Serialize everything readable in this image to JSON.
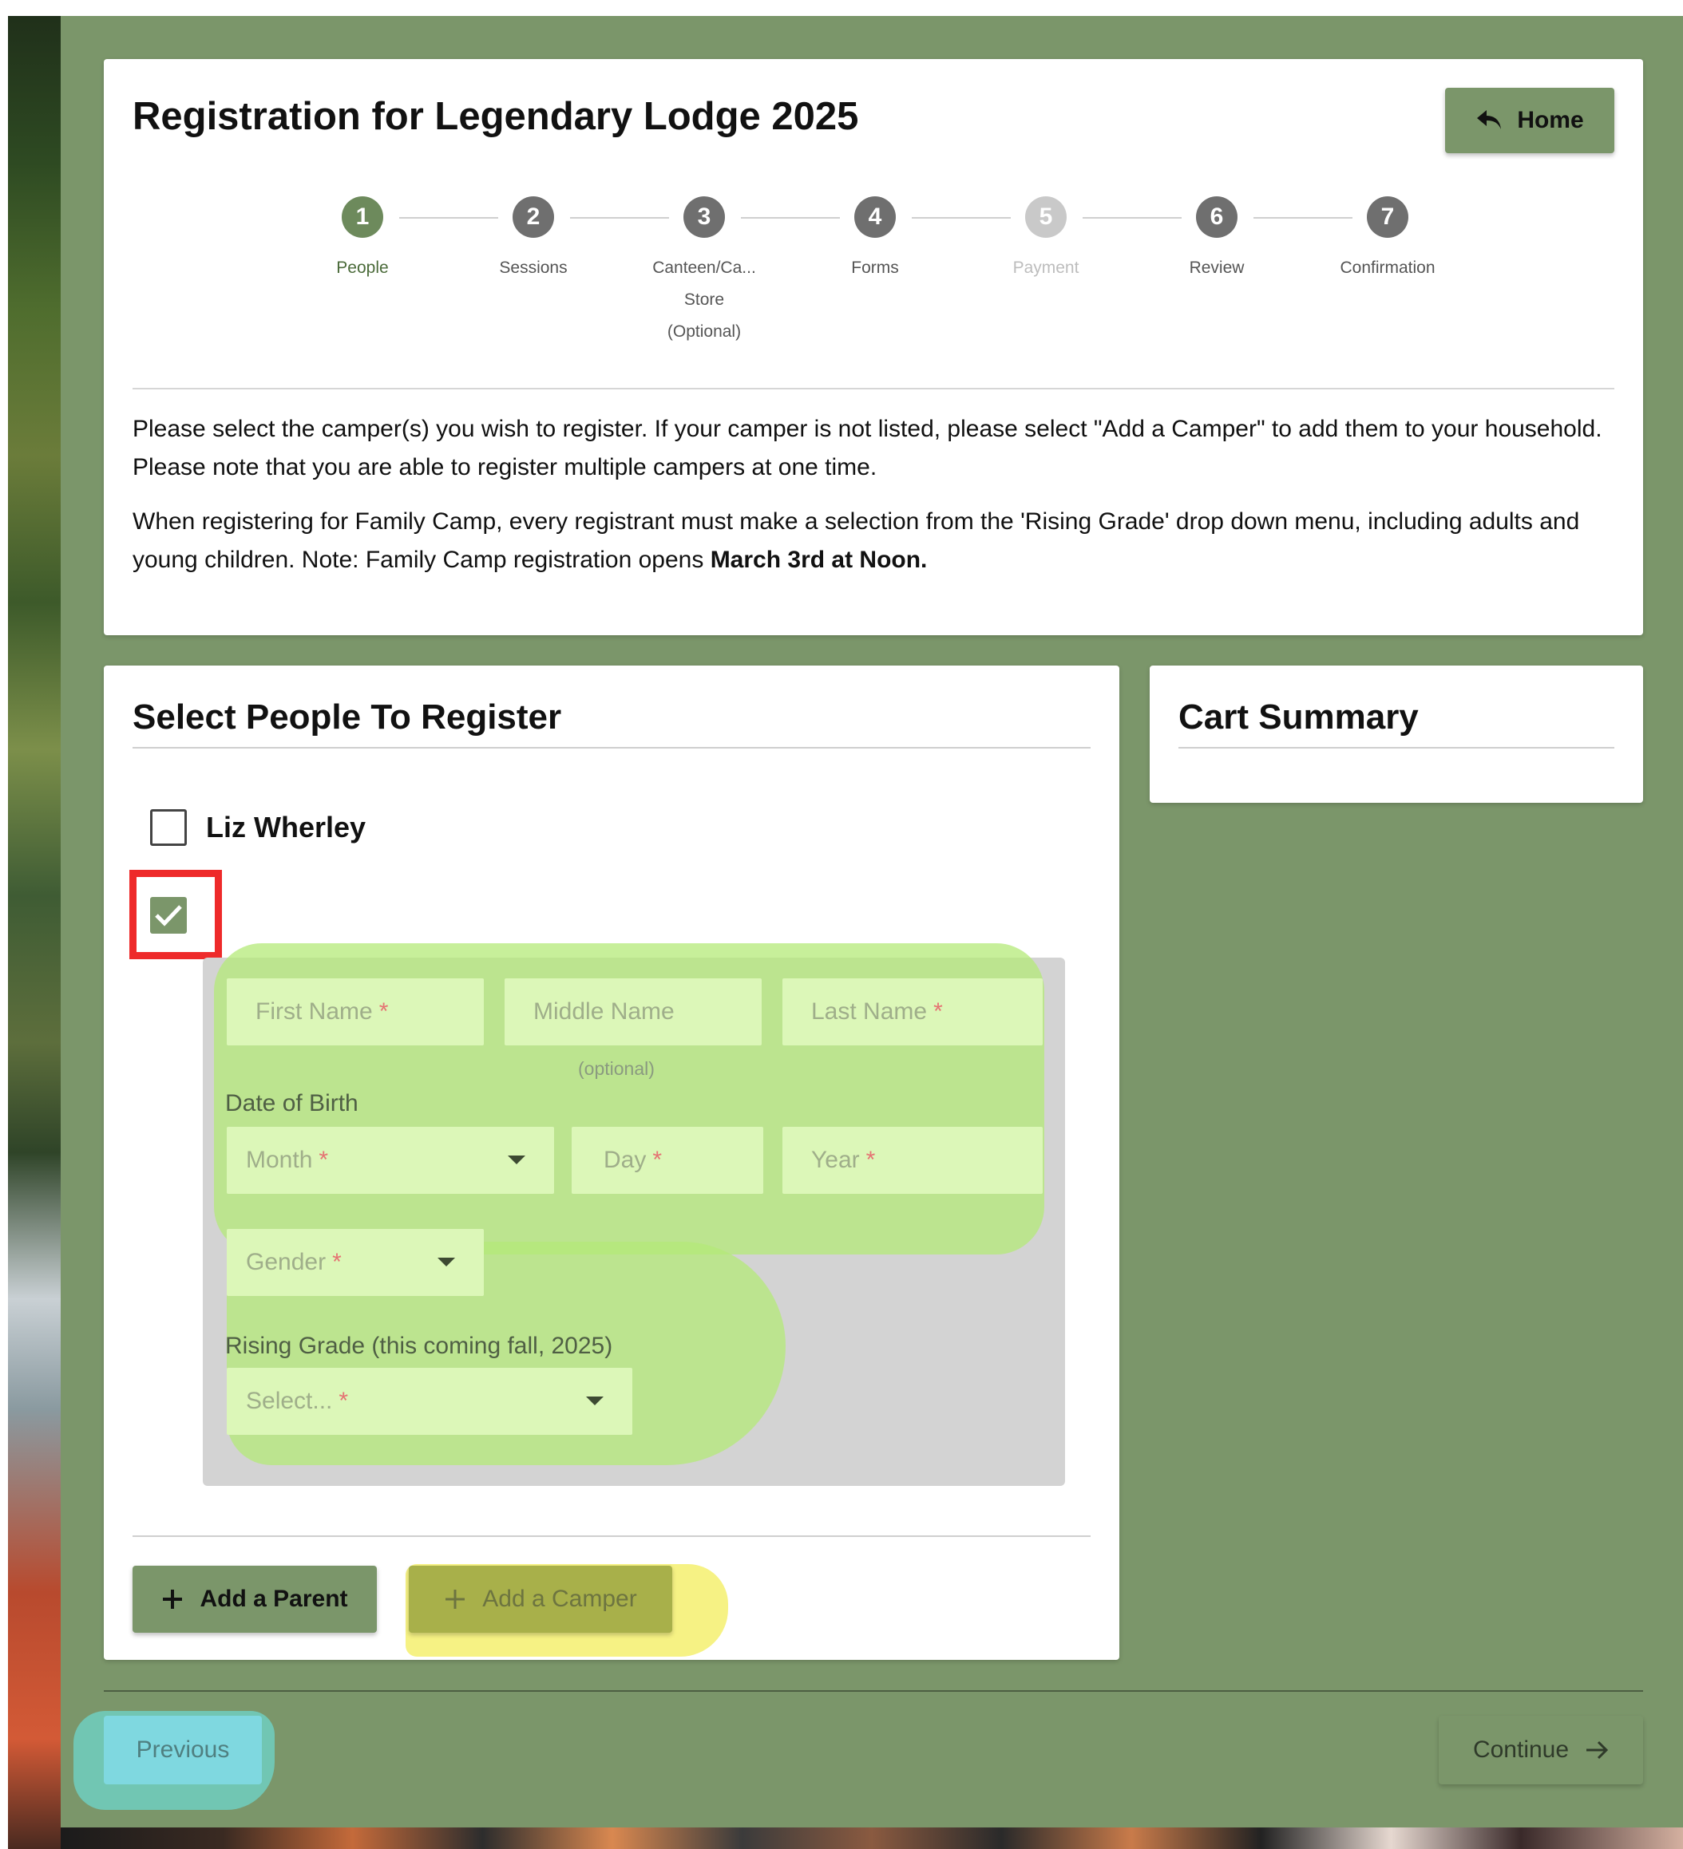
{
  "header": {
    "title": "Registration for Legendary Lodge 2025",
    "home_label": "Home"
  },
  "steps": [
    {
      "number": "1",
      "label": "People",
      "state": "active"
    },
    {
      "number": "2",
      "label": "Sessions",
      "state": "normal"
    },
    {
      "number": "3",
      "label": "Canteen/Ca...",
      "label2": "Store",
      "label3": "(Optional)",
      "state": "normal"
    },
    {
      "number": "4",
      "label": "Forms",
      "state": "normal"
    },
    {
      "number": "5",
      "label": "Payment",
      "state": "disabled"
    },
    {
      "number": "6",
      "label": "Review",
      "state": "normal"
    },
    {
      "number": "7",
      "label": "Confirmation",
      "state": "normal"
    }
  ],
  "instructions": {
    "p1": "Please select the camper(s) you wish to register. If your camper is not listed, please select \"Add a Camper\" to add them to your household. Please note that you are able to register multiple campers at one time.",
    "p2_prefix": "When registering for Family Camp, every registrant must make a selection from the 'Rising Grade' drop down menu, including adults and young children. Note: Family Camp registration opens ",
    "p2_bold": "March 3rd at Noon."
  },
  "people": {
    "title": "Select People To Register",
    "persons": [
      {
        "name": "Liz Wherley",
        "checked": false
      }
    ],
    "new_person_checked": true,
    "form": {
      "first_name_placeholder": "First Name",
      "middle_name_placeholder": "Middle Name",
      "middle_name_note": "(optional)",
      "last_name_placeholder": "Last Name",
      "dob_label": "Date of Birth",
      "month_placeholder": "Month",
      "day_placeholder": "Day",
      "year_placeholder": "Year",
      "gender_placeholder": "Gender",
      "grade_label": "Rising Grade (this coming fall, 2025)",
      "grade_placeholder": "Select...",
      "required_mark": "*"
    },
    "add_parent_label": "Add a Parent",
    "add_camper_label": "Add a Camper"
  },
  "cart": {
    "title": "Cart Summary"
  },
  "footer": {
    "previous_label": "Previous",
    "continue_label": "Continue"
  },
  "colors": {
    "brand_green": "#7b966a",
    "active_step": "#6d8a5c",
    "highlight_red": "#ee2a2a"
  }
}
